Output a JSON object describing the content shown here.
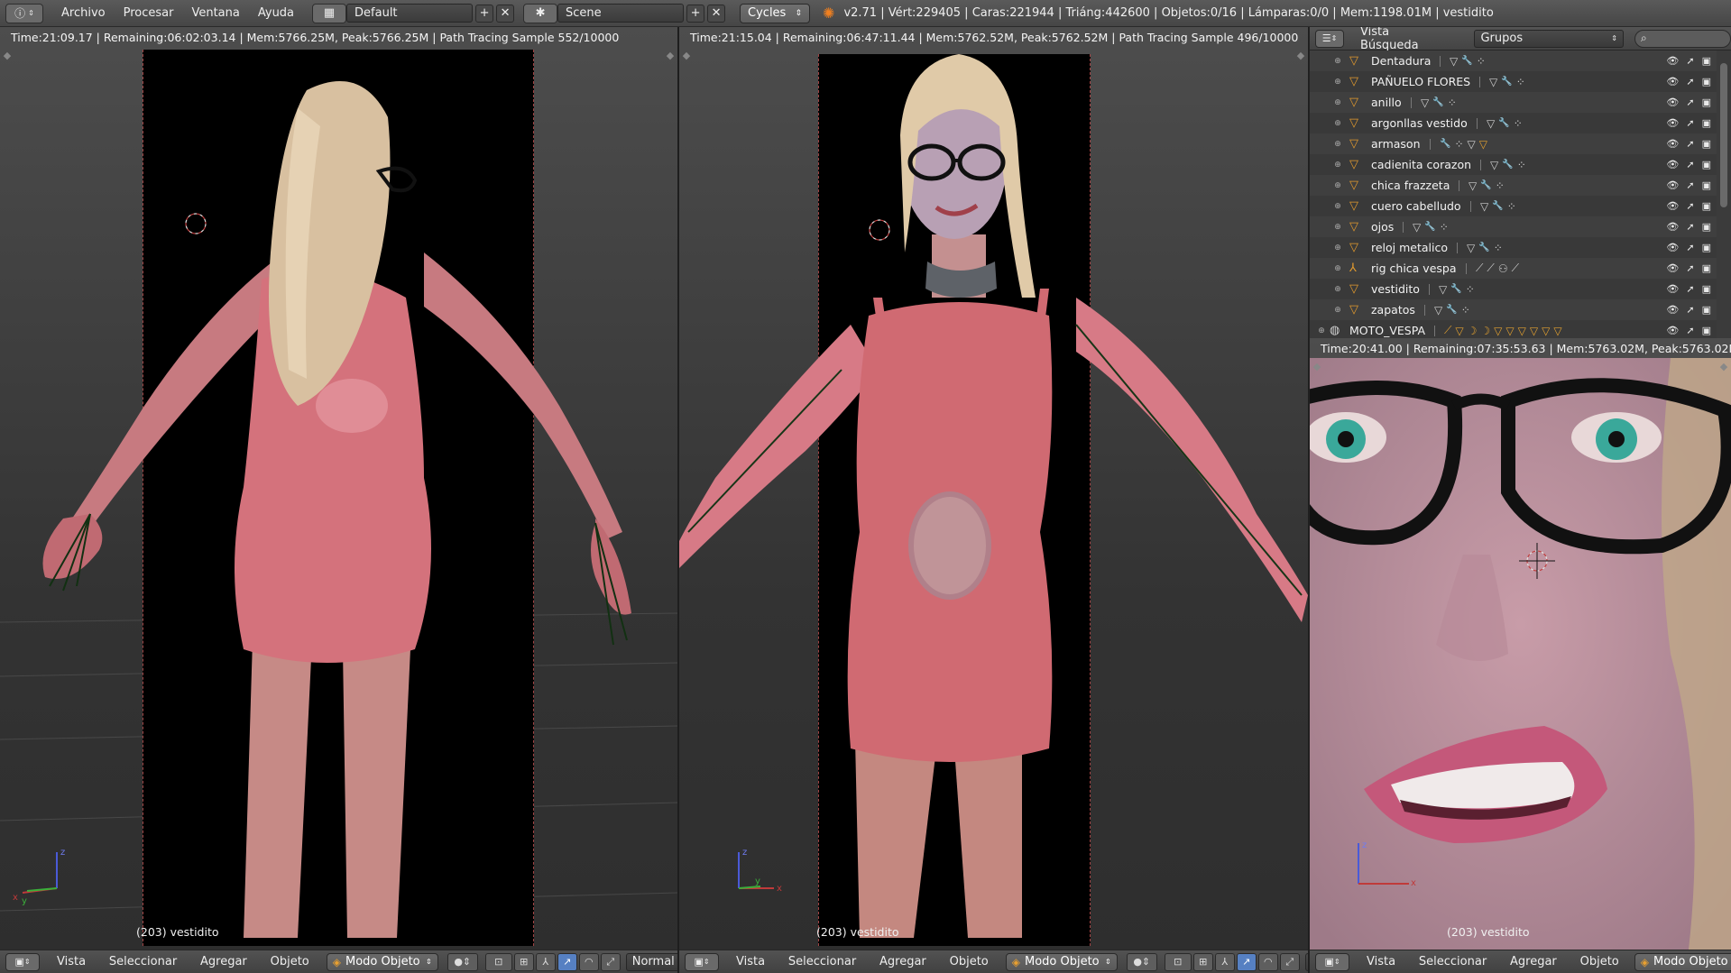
{
  "topbar": {
    "menus": [
      "Archivo",
      "Procesar",
      "Ventana",
      "Ayuda"
    ],
    "layout": "Default",
    "scene": "Scene",
    "engine": "Cycles",
    "stats": "v2.71 | Vért:229405 | Caras:221944 | Triáng:442600 | Objetos:0/16 | Lámparas:0/0 | Mem:1198.01M | vestidito"
  },
  "viewports": [
    {
      "status": "Time:21:09.17 | Remaining:06:02:03.14 | Mem:5766.25M, Peak:5766.25M | Path Tracing Sample 552/10000",
      "object_label": "(203) vestidito"
    },
    {
      "status": "Time:21:15.04 | Remaining:06:47:11.44 | Mem:5762.52M, Peak:5762.52M | Path Tracing Sample 496/10000",
      "object_label": "(203) vestidito"
    },
    {
      "status": "Time:20:41.00 | Remaining:07:35:53.63 | Mem:5763.02M, Peak:5763.02M | Path Tr",
      "object_label": "(203) vestidito"
    }
  ],
  "viewport_header": {
    "menus": [
      "Vista",
      "Seleccionar",
      "Agregar",
      "Objeto"
    ],
    "mode": "Modo Objeto",
    "orientation": "Normal"
  },
  "axes": {
    "x": "x",
    "y": "y",
    "z": "z"
  },
  "outliner": {
    "menus": [
      "Vista",
      "Búsqueda"
    ],
    "display_mode": "Grupos",
    "rows": [
      {
        "name": "Dentadura"
      },
      {
        "name": "PAÑUELO FLORES"
      },
      {
        "name": "anillo"
      },
      {
        "name": "argonllas vestido"
      },
      {
        "name": "armason"
      },
      {
        "name": "cadienita corazon"
      },
      {
        "name": "chica frazzeta"
      },
      {
        "name": "cuero cabelludo"
      },
      {
        "name": "ojos"
      },
      {
        "name": "reloj metalico"
      },
      {
        "name": "rig chica vespa"
      },
      {
        "name": "vestidito"
      },
      {
        "name": "zapatos"
      },
      {
        "name": "MOTO_VESPA"
      }
    ]
  },
  "colors": {
    "accent_blue": "#5680c2",
    "object_orange": "#e29a2e",
    "render_border": "#a04444",
    "skin": "#c4707a",
    "dress": "#d4707a"
  }
}
